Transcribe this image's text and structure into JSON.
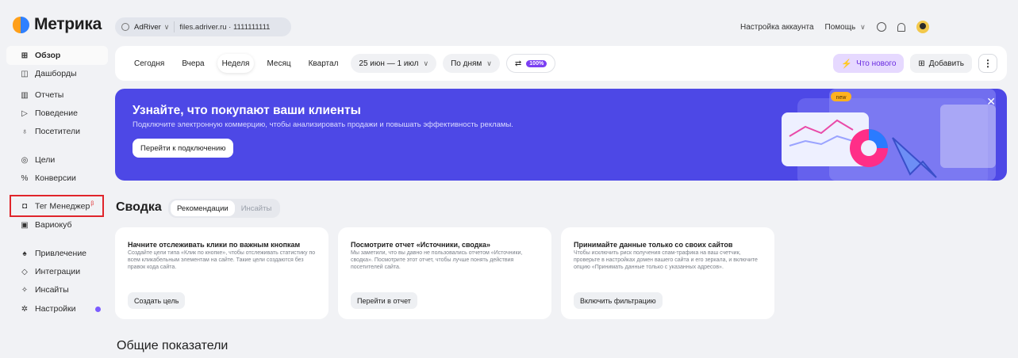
{
  "app": {
    "logo_text": "Метрика"
  },
  "site": {
    "name": "AdRiver",
    "url": "files.adriver.ru · 1111111111"
  },
  "topnav": {
    "account": "Настройка аккаунта",
    "help": "Помощь"
  },
  "sidebar": {
    "items": [
      {
        "label": "Обзор",
        "icon": "grid-icon"
      },
      {
        "label": "Дашборды",
        "icon": "dashboard-icon"
      },
      {
        "label": "Отчеты",
        "icon": "bars-icon"
      },
      {
        "label": "Поведение",
        "icon": "play-icon"
      },
      {
        "label": "Посетители",
        "icon": "user-icon"
      },
      {
        "label": "Цели",
        "icon": "target-icon"
      },
      {
        "label": "Конверсии",
        "icon": "percent-icon"
      },
      {
        "label": "Тег Менеджер",
        "icon": "tag-icon",
        "badge": "β"
      },
      {
        "label": "Вариокуб",
        "icon": "cube-icon"
      },
      {
        "label": "Привлечение",
        "icon": "fire-icon"
      },
      {
        "label": "Интеграции",
        "icon": "plug-icon"
      },
      {
        "label": "Инсайты",
        "icon": "sparkle-icon"
      },
      {
        "label": "Настройки",
        "icon": "gear-icon"
      }
    ]
  },
  "toolbar": {
    "periods": [
      "Сегодня",
      "Вчера",
      "Неделя",
      "Месяц",
      "Квартал"
    ],
    "selected_period": "Неделя",
    "date_range": "25 июн — 1 июл",
    "grouping": "По дням",
    "sampling_badge": "100%",
    "whats_new": "Что нового",
    "add": "Добавить"
  },
  "banner": {
    "title": "Узнайте, что покупают ваши клиенты",
    "subtitle": "Подключите электронную коммерцию, чтобы анализировать продажи и повышать эффективность рекламы.",
    "button": "Перейти к подключению",
    "new_tag": "new"
  },
  "summary": {
    "title": "Сводка",
    "tabs": [
      "Рекомендации",
      "Инсайты"
    ],
    "selected_tab": "Рекомендации"
  },
  "cards": [
    {
      "title": "Начните отслеживать клики по важным кнопкам",
      "text": "Создайте цели типа «Клик по кнопке», чтобы отслеживать статистику по всем кликабельным элементам на сайте. Такие цели создаются без правок кода сайта.",
      "button": "Создать цель"
    },
    {
      "title": "Посмотрите отчет «Источники, сводка»",
      "text": "Мы заметили, что вы давно не пользовались отчетом «Источники, сводка». Посмотрите этот отчет, чтобы лучше понять действия посетителей сайта.",
      "button": "Перейти в отчет"
    },
    {
      "title": "Принимайте данные только со своих сайтов",
      "text": "Чтобы исключить риск получения спам-трафика на ваш счетчик, проверьте в настройках домен вашего сайта и его зеркала, и включите опцию «Принимать данные только с указанных адресов».",
      "button": "Включить фильтрацию"
    }
  ],
  "section2": {
    "title": "Общие показатели"
  }
}
